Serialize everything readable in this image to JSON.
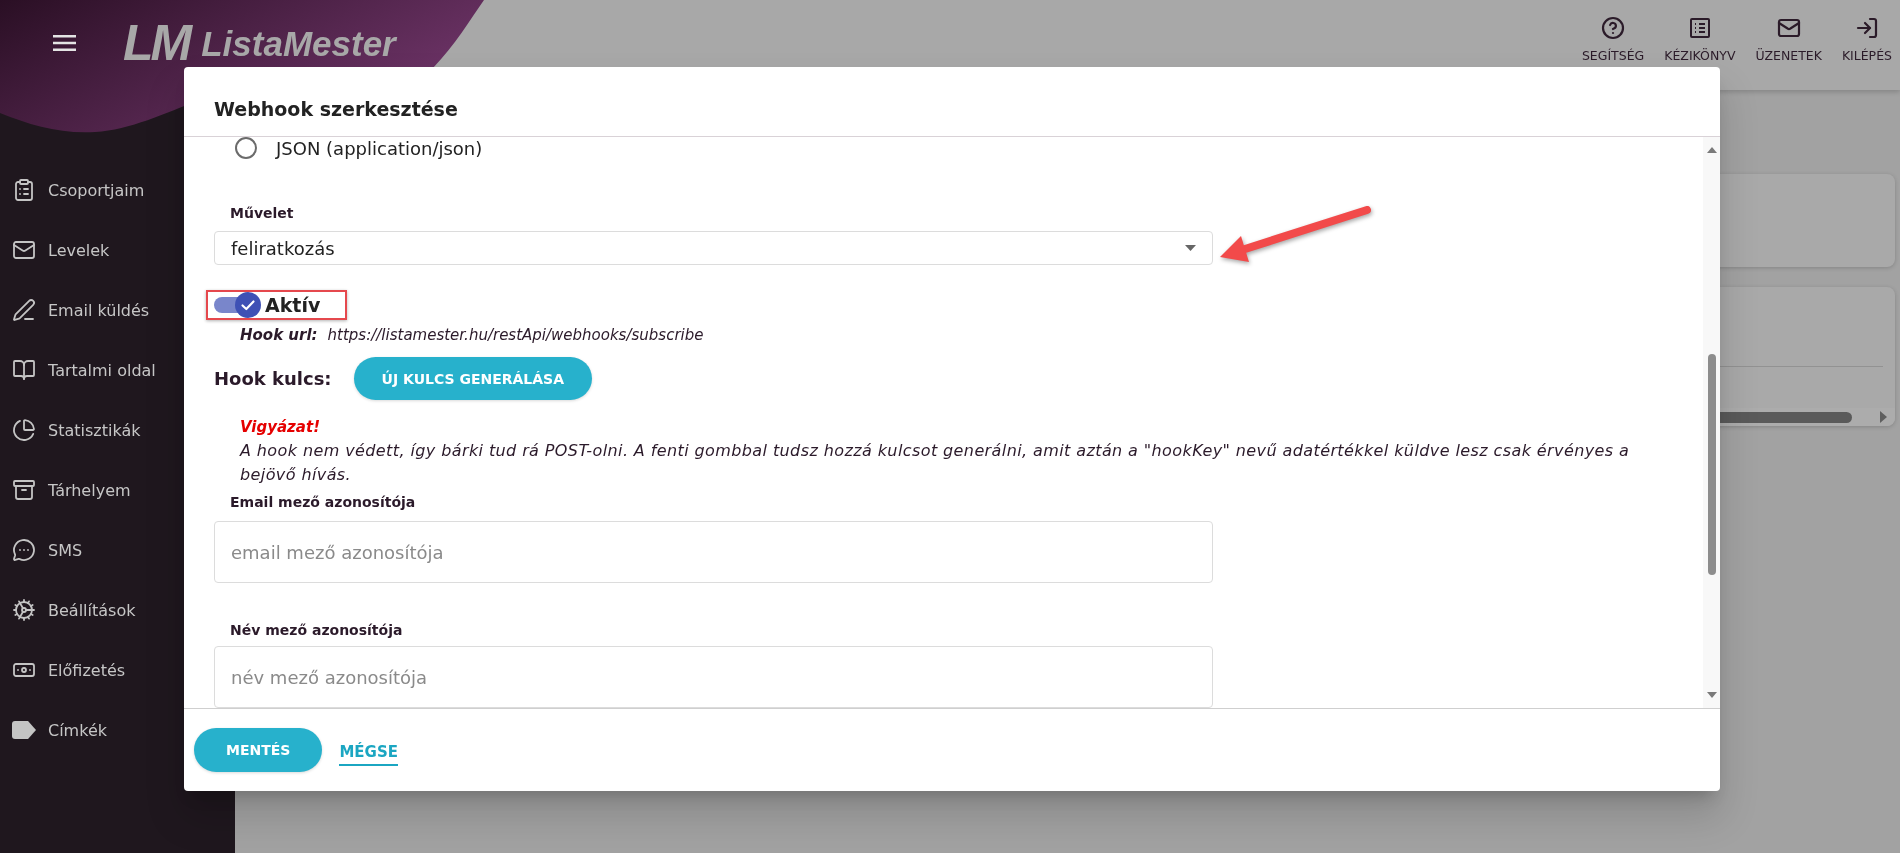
{
  "header": {
    "logo": {
      "mark": "LM",
      "name": "ListaMester"
    },
    "actions": [
      {
        "label": "SEGÍTSÉG"
      },
      {
        "label": "KÉZIKÖNYV"
      },
      {
        "label": "ÜZENETEK"
      },
      {
        "label": "KILÉPÉS"
      }
    ]
  },
  "sidebar": {
    "items": [
      {
        "label": "Csoportjaim"
      },
      {
        "label": "Levelek"
      },
      {
        "label": "Email küldés"
      },
      {
        "label": "Tartalmi oldal"
      },
      {
        "label": "Statisztikák"
      },
      {
        "label": "Tárhelyem"
      },
      {
        "label": "SMS"
      },
      {
        "label": "Beállítások"
      },
      {
        "label": "Előfizetés"
      },
      {
        "label": "Címkék"
      }
    ]
  },
  "dialog": {
    "title": "Webhook szerkesztése",
    "content_type_options": [
      {
        "label": "JSON (application/json)",
        "selected": false
      }
    ],
    "operation": {
      "label": "Művelet",
      "value": "feliratkozás"
    },
    "active_toggle": {
      "label": "Aktív",
      "on": true
    },
    "hook_url": {
      "label": "Hook url:",
      "value": "https://listamester.hu/restApi/webhooks/subscribe"
    },
    "hook_key": {
      "label": "Hook kulcs:",
      "button": "ÚJ KULCS GENERÁLÁSA"
    },
    "warning": {
      "title": "Vigyázat!",
      "text": "A hook nem védett, így bárki tud rá POST-olni. A fenti gombbal tudsz hozzá kulcsot generálni, amit aztán a \"hookKey\" nevű adatértékkel küldve lesz csak érvényes a bejövő hívás."
    },
    "fields": [
      {
        "label": "Email mező azonosítója",
        "placeholder": "email mező azonosítója"
      },
      {
        "label": "Név mező azonosítója",
        "placeholder": "név mező azonosítója"
      }
    ],
    "buttons": [
      {
        "label": "MENTÉS",
        "kind": "primary"
      },
      {
        "label": "MÉGSE",
        "kind": "link"
      }
    ]
  }
}
